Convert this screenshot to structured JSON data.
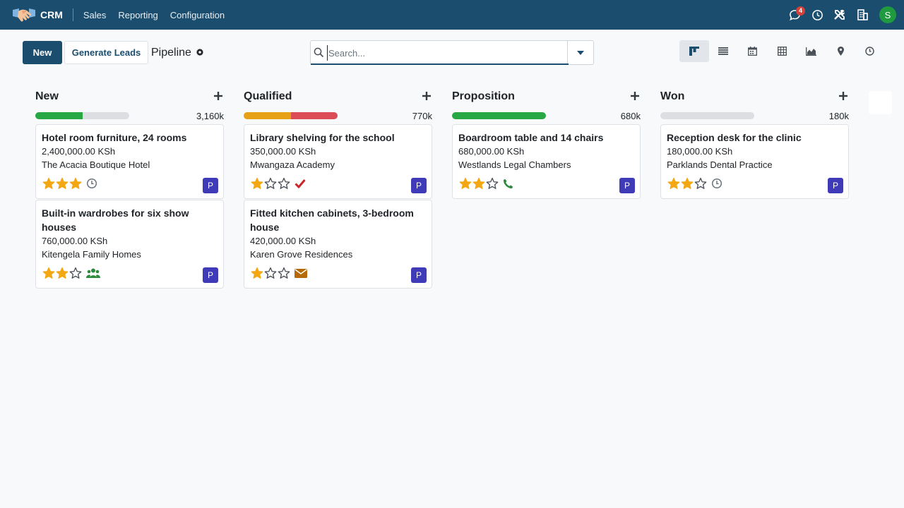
{
  "navbar": {
    "app_name": "CRM",
    "menus": [
      "Sales",
      "Reporting",
      "Configuration"
    ],
    "messages_badge": "4",
    "user_initial": "S",
    "icons": [
      "chat-icon",
      "clock-icon",
      "tools-icon",
      "building-icon"
    ]
  },
  "controls": {
    "new_label": "New",
    "generate_label": "Generate Leads",
    "breadcrumb": "Pipeline",
    "search_placeholder": "Search...",
    "views": [
      "kanban-icon",
      "list-icon",
      "calendar-icon",
      "pivot-icon",
      "graph-icon",
      "map-icon",
      "activity-icon"
    ],
    "active_view": "kanban-icon"
  },
  "colors": {
    "brand": "#1b4d6e",
    "star": "#f3a712",
    "green": "#28a745",
    "orange": "#e6a117",
    "red": "#dc4c56",
    "assignee": "#3f3ab8"
  },
  "columns": [
    {
      "title": "New",
      "total": "3,160k",
      "progress": [
        {
          "color": "#28a745",
          "fraction": 0.5
        }
      ],
      "cards": [
        {
          "title": "Hotel room furniture, 24 rooms",
          "amount": "2,400,000.00 KSh",
          "customer": "The Acacia Boutique Hotel",
          "stars": 3,
          "activity": "clock",
          "assignee": "P"
        },
        {
          "title": "Built-in wardrobes for six show houses",
          "amount": "760,000.00 KSh",
          "customer": "Kitengela Family Homes",
          "stars": 2,
          "activity": "meeting",
          "assignee": "P"
        }
      ]
    },
    {
      "title": "Qualified",
      "total": "770k",
      "progress": [
        {
          "color": "#e6a117",
          "fraction": 0.5
        },
        {
          "color": "#dc4c56",
          "fraction": 0.5
        }
      ],
      "cards": [
        {
          "title": "Library shelving for the school",
          "amount": "350,000.00 KSh",
          "customer": "Mwangaza Academy",
          "stars": 1,
          "activity": "check",
          "assignee": "P"
        },
        {
          "title": "Fitted kitchen cabinets, 3-bedroom house",
          "amount": "420,000.00 KSh",
          "customer": "Karen Grove Residences",
          "stars": 1,
          "activity": "email",
          "assignee": "P"
        }
      ]
    },
    {
      "title": "Proposition",
      "total": "680k",
      "progress": [
        {
          "color": "#28a745",
          "fraction": 1.0
        }
      ],
      "cards": [
        {
          "title": "Boardroom table and 14 chairs",
          "amount": "680,000.00 KSh",
          "customer": "Westlands Legal Chambers",
          "stars": 2,
          "activity": "phone",
          "assignee": "P"
        }
      ]
    },
    {
      "title": "Won",
      "total": "180k",
      "progress": [],
      "cards": [
        {
          "title": "Reception desk for the clinic",
          "amount": "180,000.00 KSh",
          "customer": "Parklands Dental Practice",
          "stars": 2,
          "activity": "clock",
          "assignee": "P"
        }
      ]
    }
  ]
}
